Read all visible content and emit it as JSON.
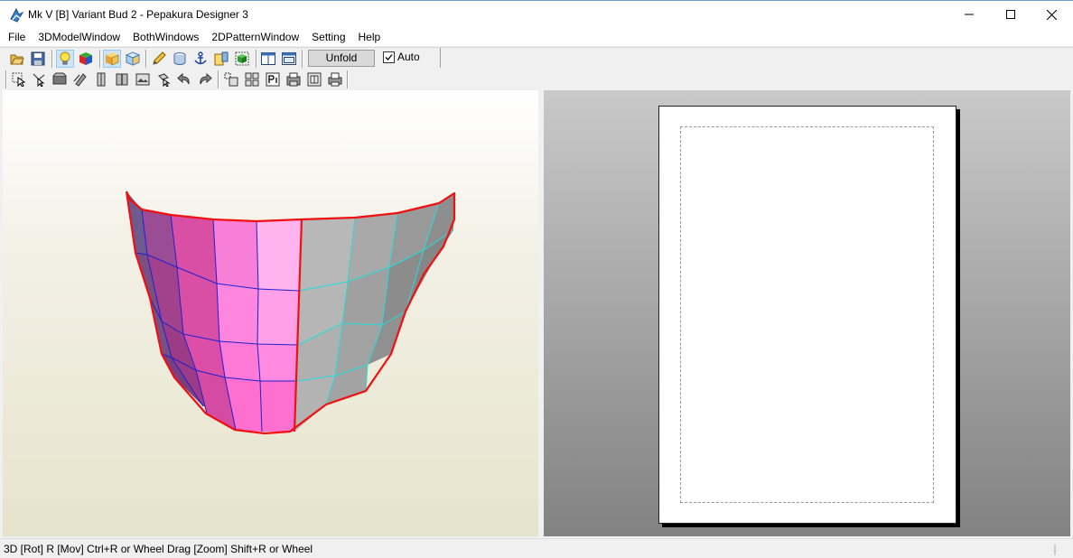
{
  "window": {
    "title": "Mk V [B] Variant Bud 2 - Pepakura Designer 3",
    "controls": [
      "minimize-icon",
      "maximize-icon",
      "close-icon"
    ]
  },
  "menu": {
    "items": [
      {
        "label": "File"
      },
      {
        "label": "3DModelWindow"
      },
      {
        "label": "BothWindows"
      },
      {
        "label": "2DPatternWindow"
      },
      {
        "label": "Setting"
      },
      {
        "label": "Help"
      }
    ]
  },
  "toolbar": {
    "row1_icons": [
      "open-folder-icon",
      "save-icon",
      "lightbulb-icon",
      "color-cube-icon",
      "texture-cube-icon",
      "wireframe-cube-icon",
      "pencil-icon",
      "cylinder-icon",
      "anchor-icon",
      "edit-part-icon",
      "green-part-icon",
      "single-pane-icon",
      "dual-pane-icon"
    ],
    "row1_active": [
      "lightbulb-icon",
      "texture-cube-icon"
    ],
    "unfold_label": "Unfold",
    "auto_label": "Auto",
    "auto_checked": true,
    "row2_icons": [
      "select-arrow-icon",
      "join-edge-icon",
      "flap-icon",
      "rotate-part-icon",
      "mirror-icon",
      "fold-line-icon",
      "image-icon",
      "move-part-icon",
      "undo-icon",
      "redo-icon",
      "arrange-icon",
      "arrange-grid-icon",
      "page-number-icon",
      "print-setup-icon",
      "zoom-fit-icon",
      "print-icon"
    ]
  },
  "status": {
    "text": "3D [Rot] R [Mov] Ctrl+R or Wheel Drag [Zoom] Shift+R or Wheel"
  },
  "colors": {
    "selected_edge": "#ee1111",
    "pink_faces": "#ff77c8",
    "gray_faces": "#a8a8a8",
    "blue_fold": "#2020cc",
    "cyan_fold": "#22dddd"
  }
}
